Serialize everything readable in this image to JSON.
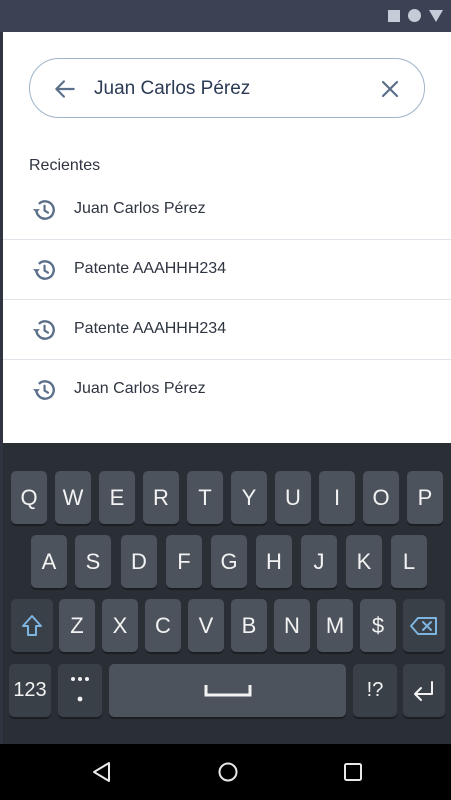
{
  "colors": {
    "status_bar": "#3b4253",
    "search_border": "#9eb3c8",
    "icon": "#5b6f8a",
    "keyboard_bg": "#2a2f36",
    "key": "#4c535c",
    "accent": "#7db4e0"
  },
  "status_bar": {
    "icons": [
      "square-icon",
      "circle-icon",
      "triangle-icon"
    ]
  },
  "search": {
    "value": "Juan Carlos Pérez",
    "back_icon": "arrow-left-icon",
    "clear_icon": "close-icon"
  },
  "recent": {
    "title": "Recientes",
    "items": [
      {
        "label": "Juan Carlos Pérez"
      },
      {
        "label": "Patente AAAHHH234"
      },
      {
        "label": "Patente AAAHHH234"
      },
      {
        "label": "Juan Carlos Pérez"
      }
    ]
  },
  "keyboard": {
    "row1": [
      "Q",
      "W",
      "E",
      "R",
      "T",
      "Y",
      "U",
      "I",
      "O",
      "P"
    ],
    "row2": [
      "A",
      "S",
      "D",
      "F",
      "G",
      "H",
      "J",
      "K",
      "L"
    ],
    "row3": [
      "Z",
      "X",
      "C",
      "V",
      "B",
      "N",
      "M",
      "$"
    ],
    "numbers_label": "123",
    "punct_label": "!?",
    "shift_icon": "shift-icon",
    "backspace_icon": "backspace-icon",
    "enter_icon": "enter-icon",
    "space_icon": "space-icon",
    "ellipsis_icon": "dots-icon"
  },
  "nav_bar": {
    "icons": [
      "back-triangle-icon",
      "home-circle-icon",
      "recents-square-icon"
    ]
  }
}
